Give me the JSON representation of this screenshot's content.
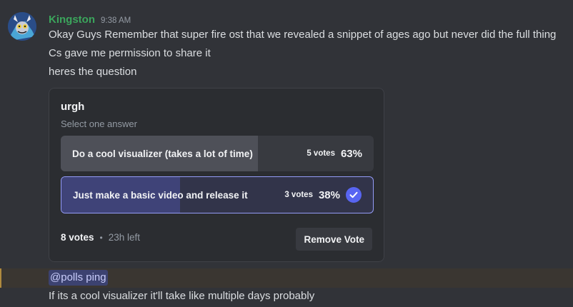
{
  "message": {
    "username": "Kingston",
    "timestamp": "9:38 AM",
    "lines": [
      "Okay Guys Remember that super fire ost that we revealed a snippet of ages ago but never did the full thing",
      "Cs gave me permission to share it",
      "heres the question"
    ]
  },
  "poll": {
    "question": "urgh",
    "hint": "Select one answer",
    "answers": [
      {
        "label": "Do a cool visualizer (takes a lot of time)",
        "votes": "5 votes",
        "percent": "63%",
        "fill_fraction": 0.63,
        "selected": false
      },
      {
        "label": "Just make a basic video and release it",
        "votes": "3 votes",
        "percent": "38%",
        "fill_fraction": 0.38,
        "selected": true
      }
    ],
    "total_votes": "8 votes",
    "separator": "•",
    "time_left": "23h left",
    "remove_vote_label": "Remove Vote"
  },
  "followup": {
    "mention": "@polls ping",
    "text": "If its a cool visualizer it'll take like multiple days probably"
  },
  "icons": {
    "avatar": "avatar-icon",
    "selected": "checkmark-icon"
  },
  "colors": {
    "username": "#3ba55c",
    "accent": "#5865f2",
    "selected_border": "#949cf7"
  }
}
